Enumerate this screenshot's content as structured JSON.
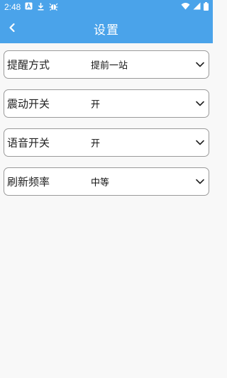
{
  "status_bar": {
    "time": "2:48",
    "left_icons": [
      "a-icon",
      "download-icon",
      "bug-icon"
    ],
    "right_icons": [
      "wifi-icon",
      "signal-icon",
      "battery-icon"
    ]
  },
  "app_bar": {
    "title": "设置",
    "back_icon": "chevron-left-icon"
  },
  "settings": [
    {
      "label": "提醒方式",
      "value": "提前一站"
    },
    {
      "label": "震动开关",
      "value": "开"
    },
    {
      "label": "语音开关",
      "value": "开"
    },
    {
      "label": "刷新频率",
      "value": "中等"
    }
  ],
  "colors": {
    "accent": "#4aa3ea",
    "background": "#f8f8f8",
    "row_border": "#9a9a9a"
  }
}
